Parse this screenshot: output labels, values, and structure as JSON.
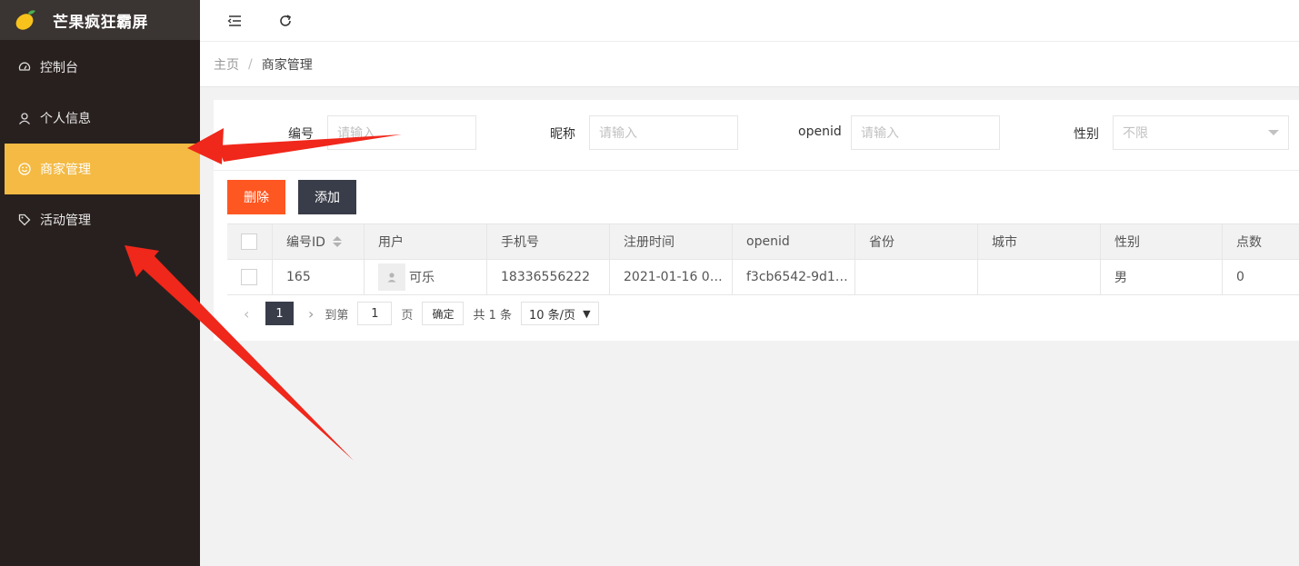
{
  "app": {
    "title": "芒果疯狂霸屏"
  },
  "sidebar": {
    "items": [
      {
        "label": "控制台",
        "icon": "dashboard-icon"
      },
      {
        "label": "个人信息",
        "icon": "user-icon"
      },
      {
        "label": "商家管理",
        "icon": "smile-icon",
        "active": true
      },
      {
        "label": "活动管理",
        "icon": "tag-icon"
      }
    ]
  },
  "breadcrumb": {
    "home": "主页",
    "separator": "/",
    "current": "商家管理"
  },
  "filters": {
    "id_label": "编号",
    "id_placeholder": "请输入",
    "nick_label": "昵称",
    "nick_placeholder": "请输入",
    "openid_label": "openid",
    "openid_placeholder": "请输入",
    "gender_label": "性别",
    "gender_value": "不限"
  },
  "toolbar": {
    "delete_label": "删除",
    "add_label": "添加"
  },
  "table": {
    "headers": [
      "编号ID",
      "用户",
      "手机号",
      "注册时间",
      "openid",
      "省份",
      "城市",
      "性别",
      "点数"
    ],
    "rows": [
      {
        "id": "165",
        "user": "可乐",
        "phone": "18336556222",
        "reg_time": "2021-01-16 0…",
        "openid": "f3cb6542-9d1…",
        "province": "",
        "city": "",
        "gender": "男",
        "points": "0"
      }
    ]
  },
  "pager": {
    "current": "1",
    "goto_label": "到第",
    "goto_value": "1",
    "page_label": "页",
    "ok_label": "确定",
    "total": "共 1 条",
    "page_size": "10 条/页"
  },
  "colors": {
    "accent": "#f4ba43",
    "sidebar": "#28201e",
    "danger": "#ff5722",
    "dark_button": "#393d49",
    "annotation_arrow": "#f0271b"
  }
}
